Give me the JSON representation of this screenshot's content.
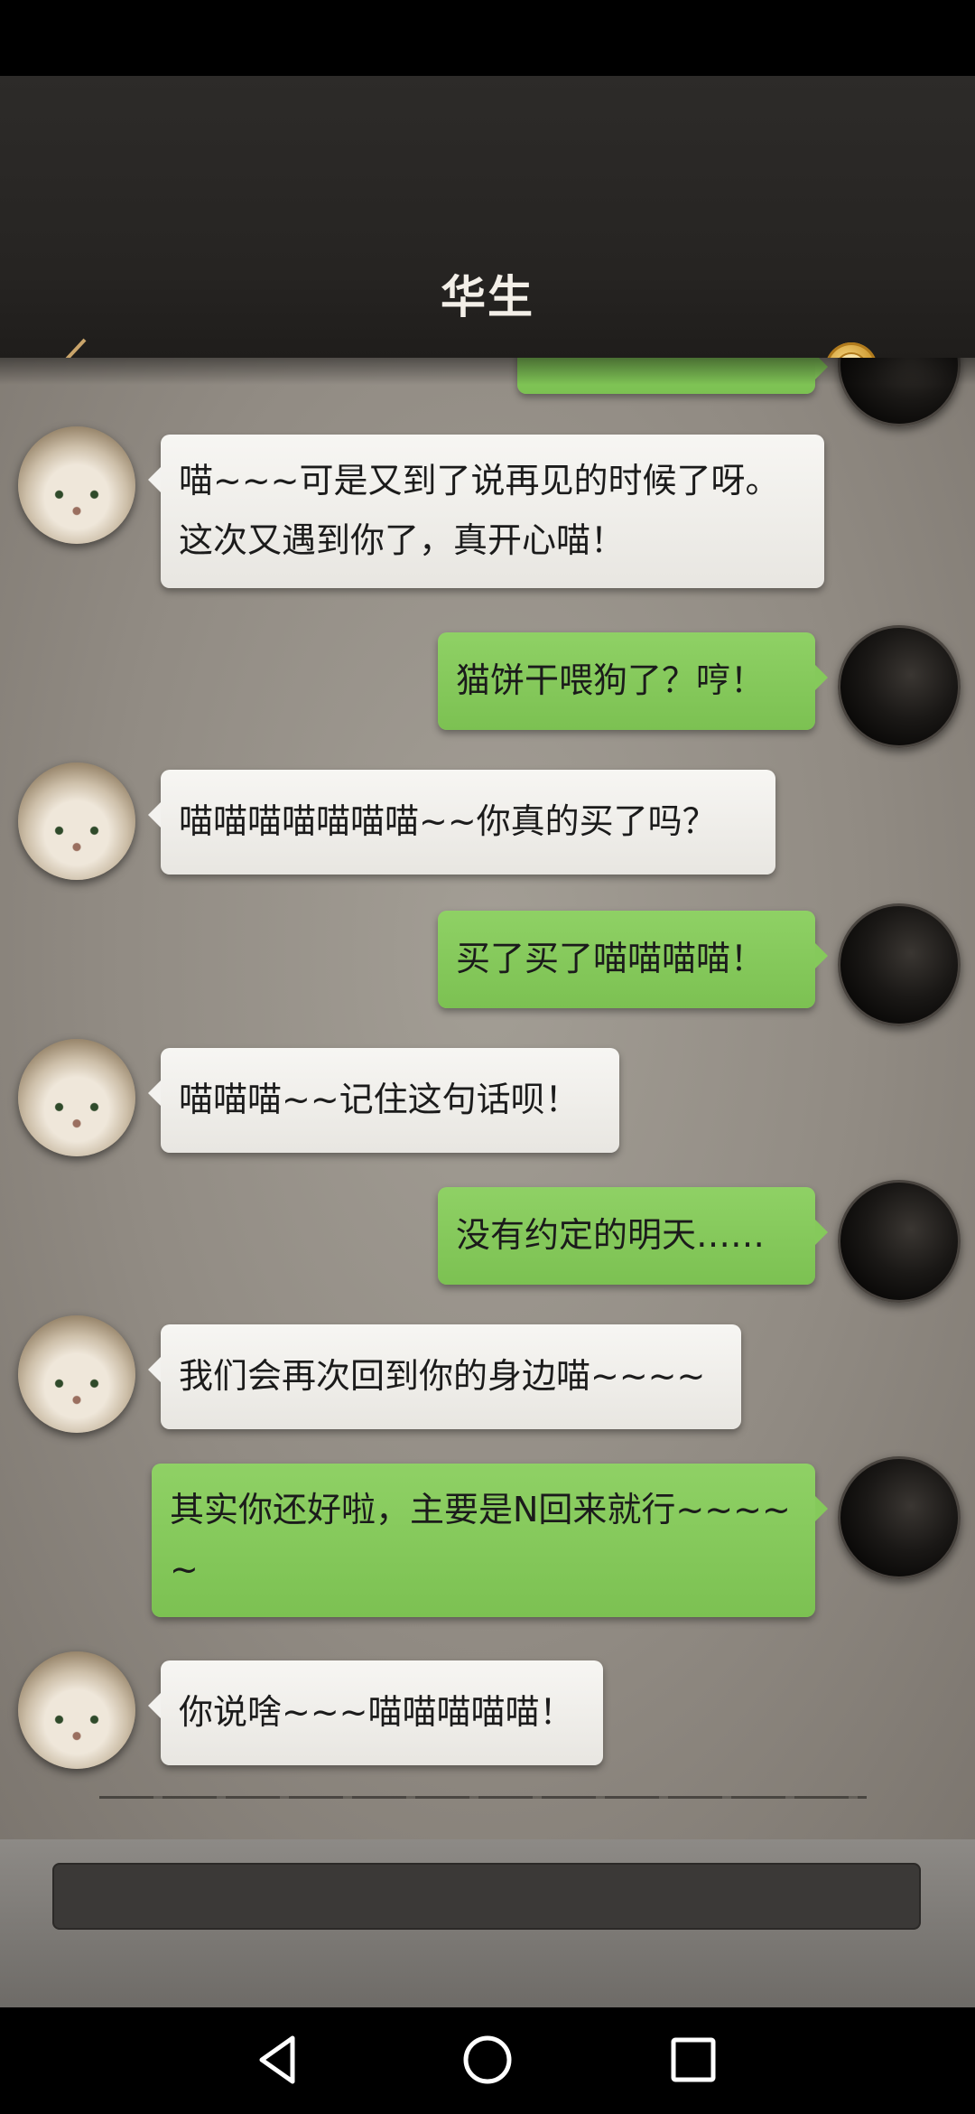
{
  "header": {
    "title": "华生",
    "back_icon": "chevron-left-icon",
    "badge_icon": "infinity-coin-icon",
    "accent_color": "#e2b45c"
  },
  "messages": [
    {
      "sender": "them",
      "text": "喵~~~可是又到了说再见的时候了呀。这次又遇到你了，真开心喵！"
    },
    {
      "sender": "me",
      "text": "猫饼干喂狗了？哼！"
    },
    {
      "sender": "them",
      "text": "喵喵喵喵喵喵喵~~你真的买了吗？"
    },
    {
      "sender": "me",
      "text": "买了买了喵喵喵喵！"
    },
    {
      "sender": "them",
      "text": "喵喵喵~~记住这句话呗！"
    },
    {
      "sender": "me",
      "text": "没有约定的明天……"
    },
    {
      "sender": "them",
      "text": "我们会再次回到你的身边喵~~~~"
    },
    {
      "sender": "me",
      "text": "其实你还好啦，主要是N回来就行~~~~~"
    },
    {
      "sender": "them",
      "text": "你说啥~~~喵喵喵喵喵！"
    }
  ],
  "input": {
    "value": "",
    "placeholder": ""
  },
  "nav": {
    "back_icon": "triangle-back-icon",
    "home_icon": "circle-home-icon",
    "recents_icon": "square-recents-icon"
  }
}
